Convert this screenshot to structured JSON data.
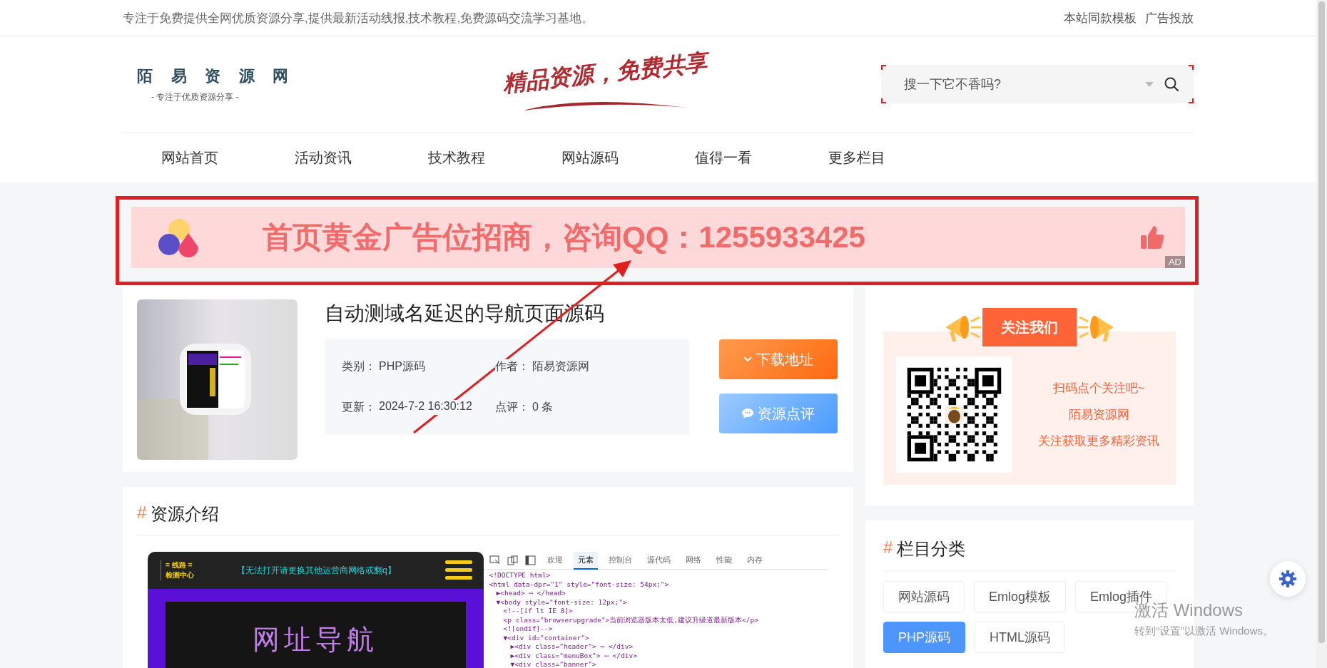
{
  "top_bar": {
    "tagline": "专注于免费提供全网优质资源分享,提供最新活动线报,技术教程,免费源码交流学习基地。",
    "links": [
      "本站同款模板",
      "广告投放"
    ]
  },
  "header": {
    "logo": {
      "name": "陌 易 资 源 网",
      "subtitle": "- 专注于优质资源分享 -"
    },
    "slogan": "精品资源，免费共享",
    "search": {
      "placeholder": "搜一下它不香吗?"
    }
  },
  "nav": [
    {
      "label": "网站首页"
    },
    {
      "label": "活动资讯"
    },
    {
      "label": "技术教程"
    },
    {
      "label": "网站源码"
    },
    {
      "label": "值得一看"
    },
    {
      "label": "更多栏目"
    }
  ],
  "ad_banner": {
    "text": "首页黄金广告位招商，咨询QQ：1255933425",
    "badge": "AD"
  },
  "resource": {
    "title": "自动测域名延迟的导航页面源码",
    "meta": [
      {
        "label": "类别：",
        "value": "PHP源码"
      },
      {
        "label": "作者：",
        "value": "陌易资源网"
      },
      {
        "label": "更新：",
        "value": "2024-7-2 16:30:12"
      },
      {
        "label": "点评：",
        "value": "0 条"
      }
    ],
    "buttons": [
      {
        "label": "下载地址",
        "kind": "download"
      },
      {
        "label": "资源点评",
        "kind": "comment"
      }
    ]
  },
  "follow": {
    "title": "关注我们",
    "lines": [
      "扫码点个关注吧~",
      "陌易资源网",
      "关注获取更多精彩资讯"
    ]
  },
  "intro": {
    "heading_mark": "#",
    "heading": "资源介绍",
    "screenshot": {
      "line_badge": "= 线路 =",
      "line_sub": "检测中心",
      "notice": "【无法打开请更换其他运营商网络或翻q】",
      "banner_title": "网址导航",
      "tabs": [
        {
          "label": "欢迎",
          "selected": false
        },
        {
          "label": "元素",
          "selected": true
        },
        {
          "label": "控制台",
          "selected": false
        },
        {
          "label": "源代码",
          "selected": false
        },
        {
          "label": "网络",
          "selected": false
        },
        {
          "label": "性能",
          "selected": false
        },
        {
          "label": "内存",
          "selected": false
        }
      ],
      "code": [
        {
          "text": "<!DOCTYPE html>"
        },
        {
          "text": "<html data-dpr=\"1\" style=\"font-size: 54px;\">",
          "children": [
            {
              "text": "▶<head> ⋯ </head>"
            },
            {
              "text": "▼<body style=\"font-size: 12px;\">",
              "children": [
                {
                  "text": "<!--[if lt IE 8]>"
                },
                {
                  "text": "<p class=\"browserupgrade\">当前浏览器版本太低,建议升级道最新版本</p>"
                },
                {
                  "text": "<![endif]-->"
                },
                {
                  "text": "▼<div id=\"container\">",
                  "children": [
                    {
                      "text": "▶<div class=\"header\"> ⋯ </div>"
                    },
                    {
                      "text": "▶<div class=\"menuBox\"> ⋯ </div>"
                    },
                    {
                      "text": "▼<div class=\"banner\">"
                    }
                  ]
                }
              ]
            }
          ]
        }
      ]
    }
  },
  "categories": {
    "heading_mark": "#",
    "heading": "栏目分类",
    "items": [
      {
        "label": "网站源码",
        "selected": false
      },
      {
        "label": "Emlog模板",
        "selected": false
      },
      {
        "label": "Emlog插件",
        "selected": false
      },
      {
        "label": "PHP源码",
        "selected": true
      },
      {
        "label": "HTML源码",
        "selected": false
      }
    ]
  },
  "windows_notice": {
    "title": "激活 Windows",
    "hint": "转到“设置”以激活 Windows。"
  }
}
